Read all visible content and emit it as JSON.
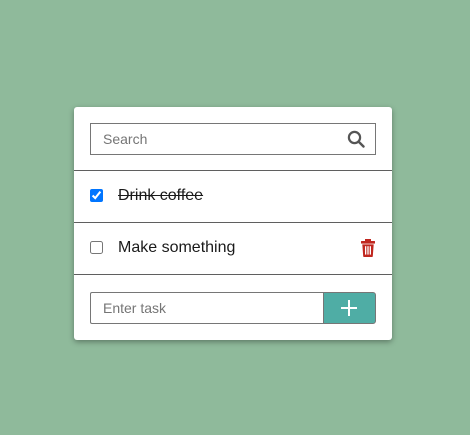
{
  "search": {
    "placeholder": "Search",
    "icon": "search-icon"
  },
  "todos": [
    {
      "label": "Drink coffee",
      "done": true
    },
    {
      "label": "Make something",
      "done": false
    }
  ],
  "add": {
    "placeholder": "Enter task",
    "button_icon": "plus-icon"
  },
  "colors": {
    "background": "#8fba9b",
    "accent": "#4fada5",
    "delete": "#c0271f",
    "checkbox": "#0075ff"
  }
}
